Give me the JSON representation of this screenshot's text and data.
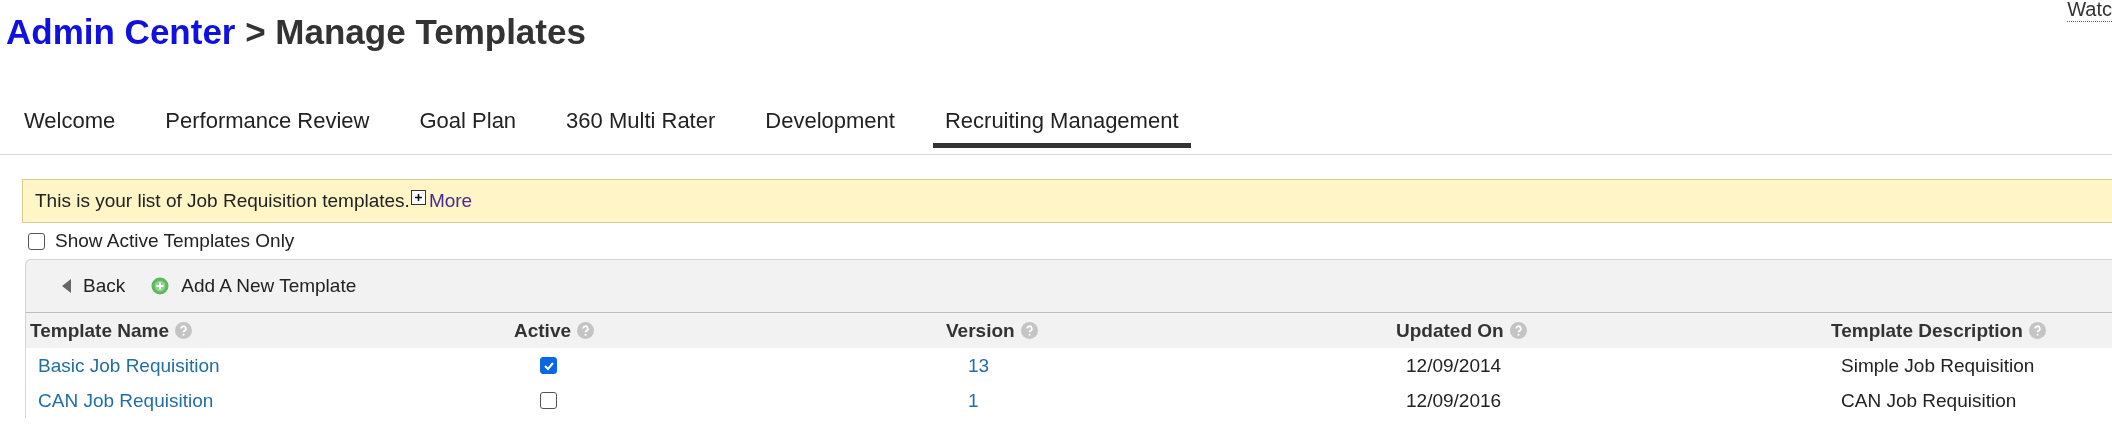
{
  "header": {
    "breadcrumb_link": "Admin Center",
    "title": "> Manage Templates",
    "watch_link": "Watc"
  },
  "tabs": [
    {
      "label": "Welcome",
      "selected": false
    },
    {
      "label": "Performance Review",
      "selected": false
    },
    {
      "label": "Goal Plan",
      "selected": false
    },
    {
      "label": "360 Multi Rater",
      "selected": false
    },
    {
      "label": "Development",
      "selected": false
    },
    {
      "label": "Recruiting Management",
      "selected": true
    }
  ],
  "info_bar": {
    "text": "This is your list of Job Requisition templates.",
    "more_link": "More"
  },
  "filter": {
    "label": "Show Active Templates Only",
    "checked": false
  },
  "toolbar": {
    "back": "Back",
    "add": "Add A New Template"
  },
  "table": {
    "columns": [
      "Template Name",
      "Active",
      "Version",
      "Updated On",
      "Template Description"
    ],
    "rows": [
      {
        "name": "Basic Job Requisition",
        "active": true,
        "version": "13",
        "updated_on": "12/09/2014",
        "description": "Simple Job Requisition"
      },
      {
        "name": "CAN Job Requisition",
        "active": false,
        "version": "1",
        "updated_on": "12/09/2016",
        "description": "CAN Job Requisition"
      }
    ]
  }
}
